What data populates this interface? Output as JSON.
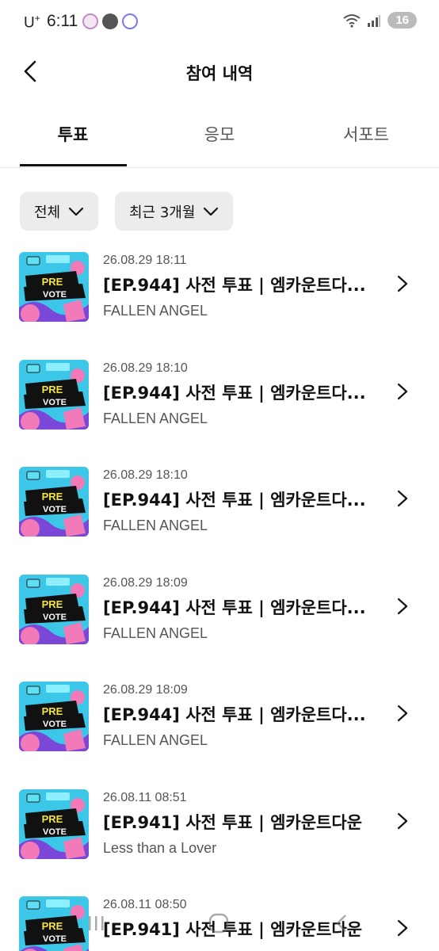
{
  "status_bar": {
    "carrier": "U",
    "carrier_sup": "+",
    "time": "6:11",
    "battery": "16"
  },
  "header": {
    "title": "참여 내역"
  },
  "tabs": [
    {
      "label": "투표",
      "active": true
    },
    {
      "label": "응모",
      "active": false
    },
    {
      "label": "서포트",
      "active": false
    }
  ],
  "filters": {
    "type": "전체",
    "period": "최근 3개월"
  },
  "thumbnail": {
    "line1": "PRE",
    "line2": "VOTE"
  },
  "items": [
    {
      "date": "26.08.29 18:11",
      "title": "[EP.944] 사전 투표 | 엠카운트다...",
      "subtitle": "FALLEN ANGEL"
    },
    {
      "date": "26.08.29 18:10",
      "title": "[EP.944] 사전 투표 | 엠카운트다...",
      "subtitle": "FALLEN ANGEL"
    },
    {
      "date": "26.08.29 18:10",
      "title": "[EP.944] 사전 투표 | 엠카운트다...",
      "subtitle": "FALLEN ANGEL"
    },
    {
      "date": "26.08.29 18:09",
      "title": "[EP.944] 사전 투표 | 엠카운트다...",
      "subtitle": "FALLEN ANGEL"
    },
    {
      "date": "26.08.29 18:09",
      "title": "[EP.944] 사전 투표 | 엠카운트다...",
      "subtitle": "FALLEN ANGEL"
    },
    {
      "date": "26.08.11 08:51",
      "title": "[EP.941] 사전 투표 | 엠카운트다운",
      "subtitle": "Less than a Lover"
    },
    {
      "date": "26.08.11 08:50",
      "title": "[EP.941] 사전 투표 | 엠카운트다운",
      "subtitle": ""
    }
  ],
  "icons": {
    "back": "chevron-left-icon",
    "dropdown": "chevron-down-icon",
    "row_arrow": "chevron-right-icon",
    "wifi": "wifi-icon",
    "signal": "signal-icon"
  },
  "colors": {
    "thumb_bg": "#3cc6e8",
    "thumb_band": "#111111",
    "thumb_pre": "#f5e53a",
    "thumb_vote": "#ffffff",
    "thumb_pink": "#f27ab8",
    "thumb_purple": "#7a47d8"
  }
}
